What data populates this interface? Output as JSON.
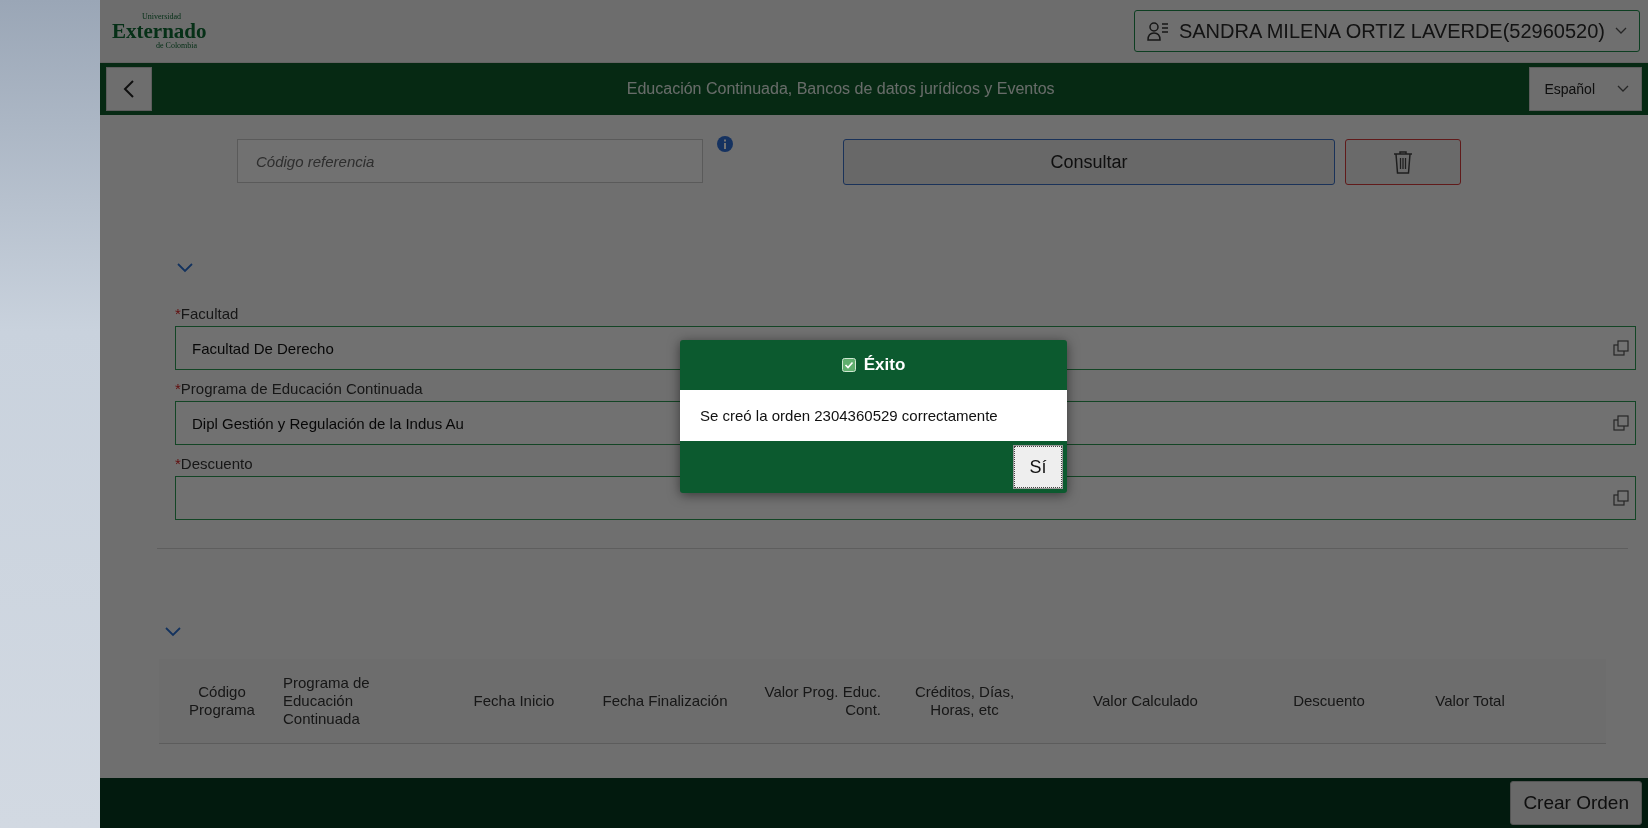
{
  "logo": {
    "top": "Universidad",
    "name": "Externado",
    "bottom": "de Colombia"
  },
  "user_menu": {
    "label": "SANDRA MILENA ORTIZ LAVERDE(52960520)"
  },
  "header": {
    "title": "Educación Continuada, Bancos de datos jurídicos y Eventos",
    "language": "Español"
  },
  "search": {
    "placeholder": "Código referencia",
    "button": "Consultar"
  },
  "form": {
    "expanded": true,
    "fields": [
      {
        "label": "Facultad",
        "required_mark": "*",
        "value": "Facultad De Derecho"
      },
      {
        "label": "Programa de Educación Continuada",
        "required_mark": "*",
        "value": "Dipl Gestión y Regulación de la Indus Au"
      },
      {
        "label": "Descuento",
        "required_mark": "*"
      }
    ]
  },
  "table": {
    "expanded": true,
    "columns": [
      {
        "label": "Código Programa"
      },
      {
        "label": "Programa de Educación Continuada"
      },
      {
        "label": "Fecha Inicio"
      },
      {
        "label": "Fecha Finalización"
      },
      {
        "label": "Valor Prog. Educ. Cont."
      },
      {
        "label": "Créditos, Días, Horas, etc"
      },
      {
        "label": "Valor Calculado"
      },
      {
        "label": "Descuento"
      },
      {
        "label": "Valor Total"
      }
    ]
  },
  "footer": {
    "button": "Crear Orden"
  },
  "dialog": {
    "title": "Éxito",
    "message": "Se creó la orden 2304360529 correctamente",
    "button": "Sí"
  }
}
